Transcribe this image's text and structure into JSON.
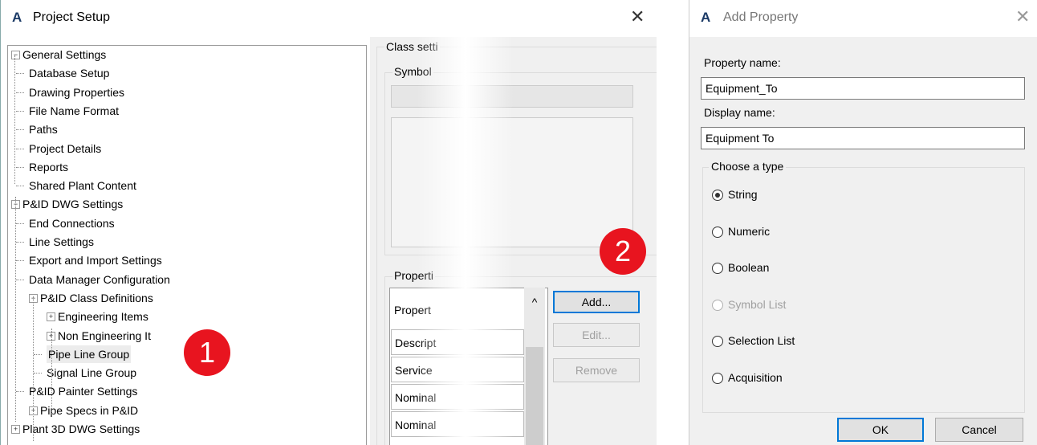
{
  "project_setup": {
    "title": "Project Setup",
    "close_glyph": "✕",
    "logo": "A",
    "tree": [
      {
        "label": "General Settings",
        "expander": "−"
      },
      {
        "label": "Database Setup"
      },
      {
        "label": "Drawing Properties"
      },
      {
        "label": "File Name Format"
      },
      {
        "label": "Paths"
      },
      {
        "label": "Project Details"
      },
      {
        "label": "Reports"
      },
      {
        "label": "Shared Plant Content"
      },
      {
        "label": "P&ID DWG Settings",
        "expander": "−"
      },
      {
        "label": "End Connections"
      },
      {
        "label": "Line Settings"
      },
      {
        "label": "Export and Import Settings"
      },
      {
        "label": "Data Manager Configuration"
      },
      {
        "label": "P&ID Class Definitions",
        "expander": "−"
      },
      {
        "label": "Engineering Items",
        "expander": "+"
      },
      {
        "label": "Non Engineering It",
        "expander": "+"
      },
      {
        "label": "Pipe Line Group"
      },
      {
        "label": "Signal Line Group"
      },
      {
        "label": "P&ID Painter Settings"
      },
      {
        "label": "Pipe Specs in P&ID",
        "expander": "+"
      },
      {
        "label": "Plant 3D DWG Settings",
        "expander": "+"
      }
    ],
    "class_settings_label": "Class setti",
    "symbol_label": "Symbol",
    "properties_label": "Properti",
    "table_header": "Propert",
    "scroll_up_glyph": "^",
    "table_rows": [
      "Descript",
      "Service",
      "Nominal",
      "Nominal"
    ],
    "buttons": {
      "add": "Add...",
      "edit": "Edit...",
      "remove": "Remove"
    },
    "badge_1": "1",
    "badge_2": "2"
  },
  "add_property": {
    "title": "Add Property",
    "close_glyph": "✕",
    "logo": "A",
    "property_name_label": "Property name:",
    "property_name_value": "Equipment_To",
    "display_name_label": "Display name:",
    "display_name_value": "Equipment To",
    "type_group_label": "Choose a type",
    "types": [
      {
        "label": "String",
        "selected": true,
        "disabled": false
      },
      {
        "label": "Numeric",
        "selected": false,
        "disabled": false
      },
      {
        "label": "Boolean",
        "selected": false,
        "disabled": false
      },
      {
        "label": "Symbol List",
        "selected": false,
        "disabled": true
      },
      {
        "label": "Selection List",
        "selected": false,
        "disabled": false
      },
      {
        "label": "Acquisition",
        "selected": false,
        "disabled": false
      }
    ],
    "ok_label": "OK",
    "cancel_label": "Cancel"
  },
  "colors": {
    "accent": "#0078d7",
    "badge": "#e8141f"
  }
}
